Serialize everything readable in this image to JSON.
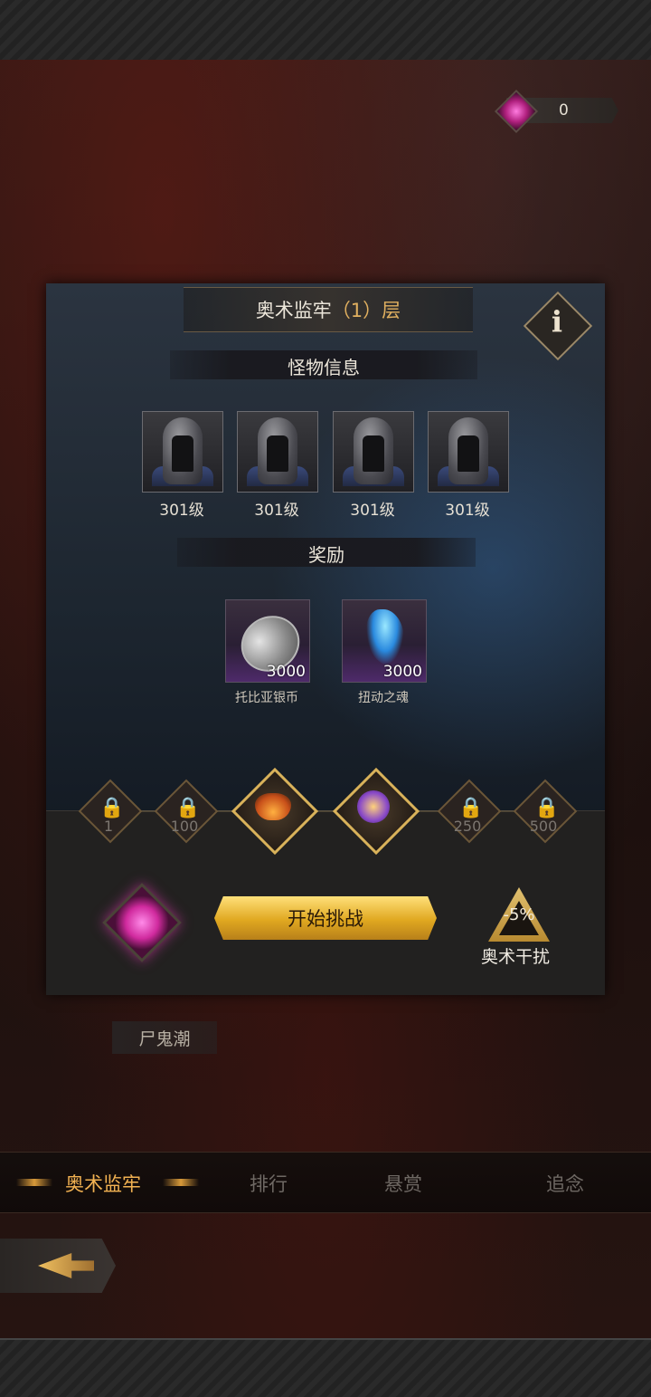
{
  "currency": {
    "value": "0",
    "icon": "pink-gem-icon"
  },
  "dungeon": {
    "title": "奥术监牢",
    "floor": "（1）层"
  },
  "sections": {
    "monster_info": "怪物信息",
    "reward": "奖励"
  },
  "monsters": [
    {
      "level": "301级",
      "icon": "helmet-knight-icon"
    },
    {
      "level": "301级",
      "icon": "helmet-knight-icon"
    },
    {
      "level": "301级",
      "icon": "helmet-knight-icon"
    },
    {
      "level": "301级",
      "icon": "helmet-knight-icon"
    }
  ],
  "rewards": [
    {
      "name": "托比亚银币",
      "qty": "3000",
      "icon": "silver-coin-icon"
    },
    {
      "name": "扭动之魂",
      "qty": "3000",
      "icon": "blue-soul-icon"
    }
  ],
  "progress_nodes": [
    {
      "label": "1",
      "locked": true
    },
    {
      "label": "100",
      "locked": true
    },
    {
      "label": "",
      "locked": false,
      "icon": "wizard-hat-icon"
    },
    {
      "label": "",
      "locked": false,
      "icon": "arcane-orb-icon"
    },
    {
      "label": "250",
      "locked": true
    },
    {
      "label": "500",
      "locked": true
    }
  ],
  "actions": {
    "start": "开始挑战"
  },
  "debuff": {
    "value": "-5%",
    "label": "奥术干扰"
  },
  "event_label": "尸鬼潮",
  "tabs": [
    {
      "label": "奥术监牢",
      "active": true
    },
    {
      "label": "排行",
      "active": false
    },
    {
      "label": "悬赏",
      "active": false
    },
    {
      "label": "追念",
      "active": false
    }
  ],
  "colors": {
    "accent": "#f2b252",
    "button": "#e0a820",
    "gem": "#d02a9e"
  }
}
